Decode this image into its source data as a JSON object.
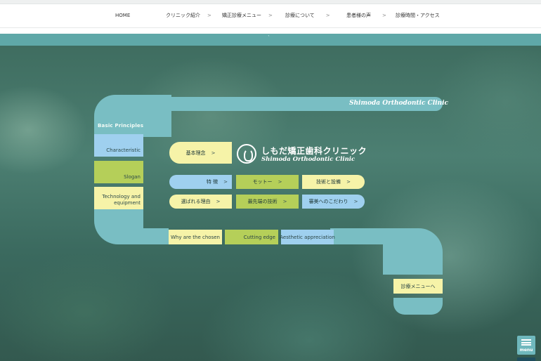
{
  "nav": {
    "items": [
      {
        "label": "HOME",
        "chevron": ""
      },
      {
        "label": "クリニック紹介",
        "chevron": ">"
      },
      {
        "label": "矯正診療メニュー",
        "chevron": ">"
      },
      {
        "label": "診療について",
        "chevron": ">"
      },
      {
        "label": "患者様の声",
        "chevron": ">"
      },
      {
        "label": "診療時間・アクセス",
        "chevron": ""
      }
    ]
  },
  "teal_bar_mark": "`",
  "hero": {
    "top_pill": "Shimoda Orthodontic Clinic",
    "sidebar_title": "Basic Principles",
    "sidebar_items": [
      "Characteristic",
      "Slogan",
      "Technology and equipment"
    ],
    "main_button": {
      "label": "基本理念",
      "arrow": ">"
    },
    "clinic_name_jp": "しもだ矯正歯科クリニック",
    "clinic_name_en": "Shimoda Orthodontic Clinic",
    "grid_row1": [
      {
        "label": "特 徴",
        "arrow": ">"
      },
      {
        "label": "モットー",
        "arrow": ">"
      },
      {
        "label": "技術と設備",
        "arrow": ">"
      }
    ],
    "grid_row2": [
      {
        "label": "選ばれる理由",
        "arrow": ">"
      },
      {
        "label": "最先端の技術",
        "arrow": ">"
      },
      {
        "label": "審美へのこだわり",
        "arrow": ">"
      }
    ],
    "bottom_items": [
      "Why are the chosen",
      "Cutting edge",
      "Aesthetic appreciation"
    ],
    "menu_link": {
      "label": "診療メニューへ",
      "arrow": ""
    }
  },
  "menu_button": {
    "label": "menu"
  },
  "colors": {
    "teal": "#79bec3",
    "yellow": "#f6f3a8",
    "green": "#b5cf59",
    "blue": "#9fd0ef"
  },
  "icons": [
    "hamburger-icon",
    "clinic-logo-icon"
  ]
}
